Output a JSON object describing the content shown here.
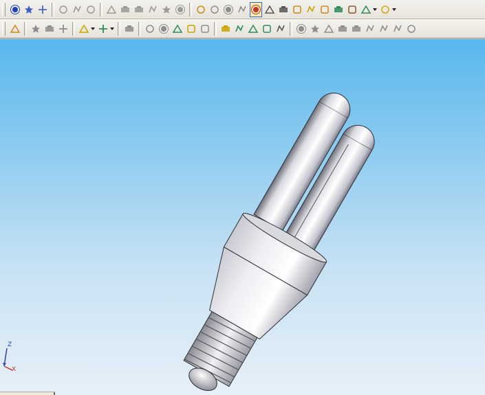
{
  "toolbar_top": {
    "groups": [
      [
        {
          "icon": "spline-icon",
          "color": "#2340b8"
        },
        {
          "icon": "point-icon",
          "color": "#3c5bc9"
        },
        {
          "icon": "sketch-grid-icon",
          "color": "#4c68c8"
        }
      ],
      [
        {
          "icon": "extrude-boss-icon",
          "color": "#9a9a9a"
        },
        {
          "icon": "revolve-boss-icon",
          "color": "#9a9a9a"
        },
        {
          "icon": "swept-boss-icon",
          "color": "#9a9a9a"
        }
      ],
      [
        {
          "icon": "extruded-cut-icon",
          "color": "#9a9a9a"
        },
        {
          "icon": "fillet-icon",
          "color": "#9a9a9a"
        },
        {
          "icon": "chamfer-icon",
          "color": "#9a9a9a"
        },
        {
          "icon": "rib-icon",
          "color": "#9a9a9a"
        },
        {
          "icon": "shell-icon",
          "color": "#9a9a9a"
        },
        {
          "icon": "draft-icon",
          "color": "#9a9a9a"
        }
      ],
      [
        {
          "icon": "assembly-tree-icon",
          "color": "#c98a1c"
        },
        {
          "icon": "mate-icon",
          "color": "#8d8d8d"
        },
        {
          "icon": "component-move-icon",
          "color": "#8d8d8d"
        },
        {
          "icon": "component-rotate-icon",
          "color": "#8d8d8d"
        },
        {
          "icon": "explode-view-icon",
          "color": "#c0392b",
          "active": true
        },
        {
          "icon": "paperclip-icon",
          "color": "#555555"
        },
        {
          "icon": "magnet-icon",
          "color": "#555555"
        },
        {
          "icon": "smart-fastener-icon",
          "color": "#c98a1c"
        },
        {
          "icon": "star-feature-icon",
          "color": "#c9a400"
        },
        {
          "icon": "configuration-icon",
          "color": "#c98a1c"
        },
        {
          "icon": "interference-icon",
          "color": "#2e8b57"
        },
        {
          "icon": "bookmark-icon",
          "color": "#8b5a2b"
        },
        {
          "icon": "appearance-icon",
          "color": "#2e8b57",
          "dropdown": true
        },
        {
          "icon": "sun-light-icon",
          "color": "#d9a400",
          "dropdown": true
        }
      ]
    ]
  },
  "toolbar_bottom": {
    "groups": [
      [
        {
          "icon": "macro-icon",
          "color": "#c98a1c"
        }
      ],
      [
        {
          "icon": "linear-pattern-icon",
          "color": "#8d8d8d"
        },
        {
          "icon": "circular-pattern-icon",
          "color": "#8d8d8d"
        },
        {
          "icon": "mirror-icon",
          "color": "#8d8d8d"
        }
      ],
      [
        {
          "icon": "sketch-wizard-icon",
          "color": "#c9a400",
          "dropdown": true
        },
        {
          "icon": "curve-spiral-icon",
          "color": "#2e8b57",
          "dropdown": true
        }
      ],
      [
        {
          "icon": "surface-planar-icon",
          "color": "#8d8d8d"
        }
      ],
      [
        {
          "icon": "surface-extrude-icon",
          "color": "#8d8d8d"
        },
        {
          "icon": "surface-loft-icon",
          "color": "#8d8d8d"
        },
        {
          "icon": "surface-sweep-icon",
          "color": "#2e8b57"
        },
        {
          "icon": "knit-surface-icon",
          "color": "#c9a400"
        },
        {
          "icon": "thicken-icon",
          "color": "#8d8d8d"
        }
      ],
      [
        {
          "icon": "reference-plane-icon",
          "color": "#c9a400"
        },
        {
          "icon": "reference-axis-icon",
          "color": "#2e8b57"
        },
        {
          "icon": "coordinate-system-icon",
          "color": "#2e8b57"
        },
        {
          "icon": "reference-point-icon",
          "color": "#2e8b57"
        },
        {
          "icon": "mate-reference-icon",
          "color": "#555555"
        }
      ],
      [
        {
          "icon": "dot-icon",
          "color": "#8d8d8d"
        },
        {
          "icon": "circle-icon",
          "color": "#8d8d8d"
        },
        {
          "icon": "line-icon",
          "color": "#8d8d8d"
        },
        {
          "icon": "polygon-icon",
          "color": "#8d8d8d"
        },
        {
          "icon": "trim-icon",
          "color": "#8d8d8d"
        },
        {
          "icon": "angle-icon",
          "color": "#8d8d8d"
        },
        {
          "icon": "offset-icon",
          "color": "#8d8d8d"
        },
        {
          "icon": "convert-entities-icon",
          "color": "#8d8d8d"
        },
        {
          "icon": "pencil-icon",
          "color": "#8d8d8d"
        }
      ]
    ]
  },
  "viewport": {
    "model": "cfl-bulb-model",
    "background_top": "#58b7ee",
    "background_bottom": "#e7f0f8"
  },
  "triad": {
    "axes": [
      {
        "label": "Z",
        "color": "#2a3fb0"
      },
      {
        "label": "X",
        "color": "#c0392b"
      }
    ]
  }
}
